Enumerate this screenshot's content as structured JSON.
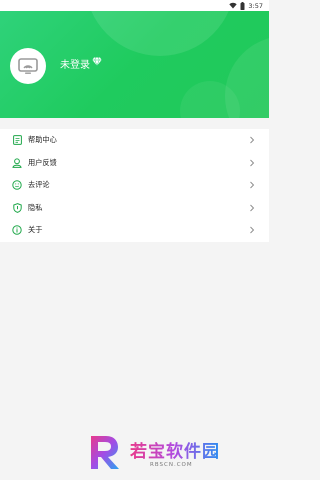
{
  "status_bar": {
    "time": "3:57"
  },
  "header": {
    "login_label": "未登录"
  },
  "menu": {
    "items": [
      {
        "label": "帮助中心",
        "icon": "help-doc-icon"
      },
      {
        "label": "用户反馈",
        "icon": "feedback-icon"
      },
      {
        "label": "去评论",
        "icon": "comment-icon"
      },
      {
        "label": "隐私",
        "icon": "privacy-shield-icon"
      },
      {
        "label": "关于",
        "icon": "about-info-icon"
      }
    ]
  },
  "watermark": {
    "title": "若宝软件园",
    "subtitle": "RBSCN.COM"
  },
  "colors": {
    "accent_green": "#22c85a",
    "icon_green": "#1fa84a"
  }
}
